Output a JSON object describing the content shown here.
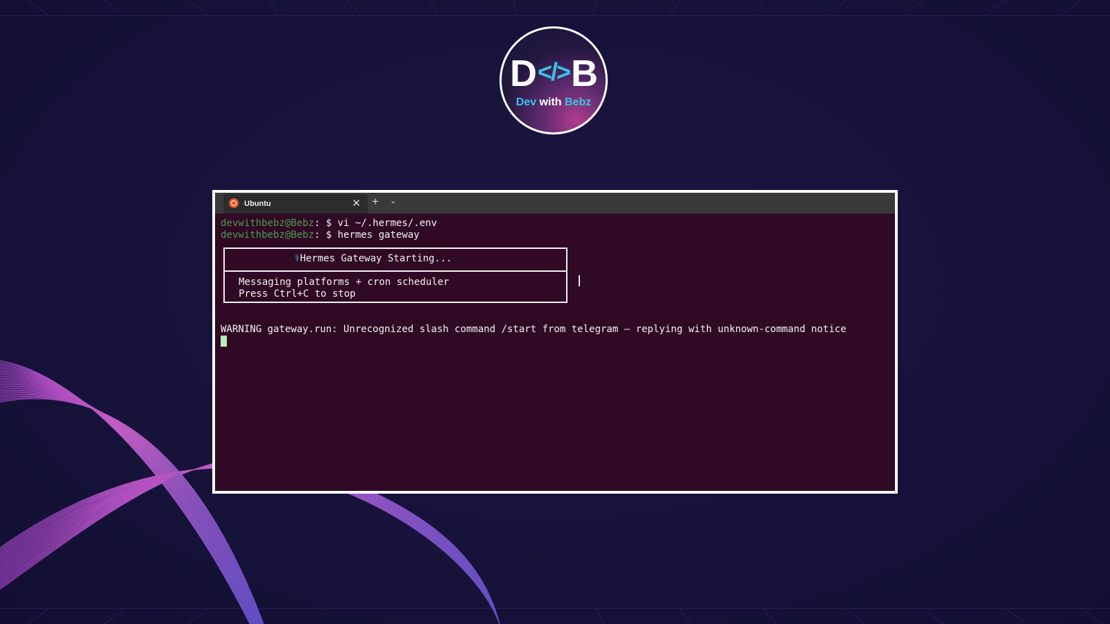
{
  "logo": {
    "mark_left": "D",
    "mark_code": "</>",
    "mark_right": "B",
    "name_part1": "Dev",
    "name_part2": " with ",
    "name_part3": "Bebz"
  },
  "terminal": {
    "tab_title": "Ubuntu",
    "tab_close": "✕",
    "new_tab": "+",
    "dropdown": "⌄",
    "lines": [
      {
        "user": "devwithbebz@Bebz",
        "sep": ":",
        "cmd": " $ vi ~/.hermes/.env"
      },
      {
        "user": "devwithbebz@Bebz",
        "sep": ":",
        "cmd": " $ hermes gateway"
      }
    ],
    "banner": {
      "bolt": "⚕",
      "title": "Hermes Gateway Starting...",
      "body1": "Messaging platforms + cron scheduler",
      "body2": "Press Ctrl+C to stop"
    },
    "warning": "WARNING gateway.run: Unrecognized slash command /start from telegram — replying with unknown-command notice"
  },
  "colors": {
    "background": "#16123a",
    "terminal_bg": "#300a24",
    "prompt": "#4e9a50",
    "accent": "#38c5e8",
    "ubuntu_orange": "#e95420"
  }
}
